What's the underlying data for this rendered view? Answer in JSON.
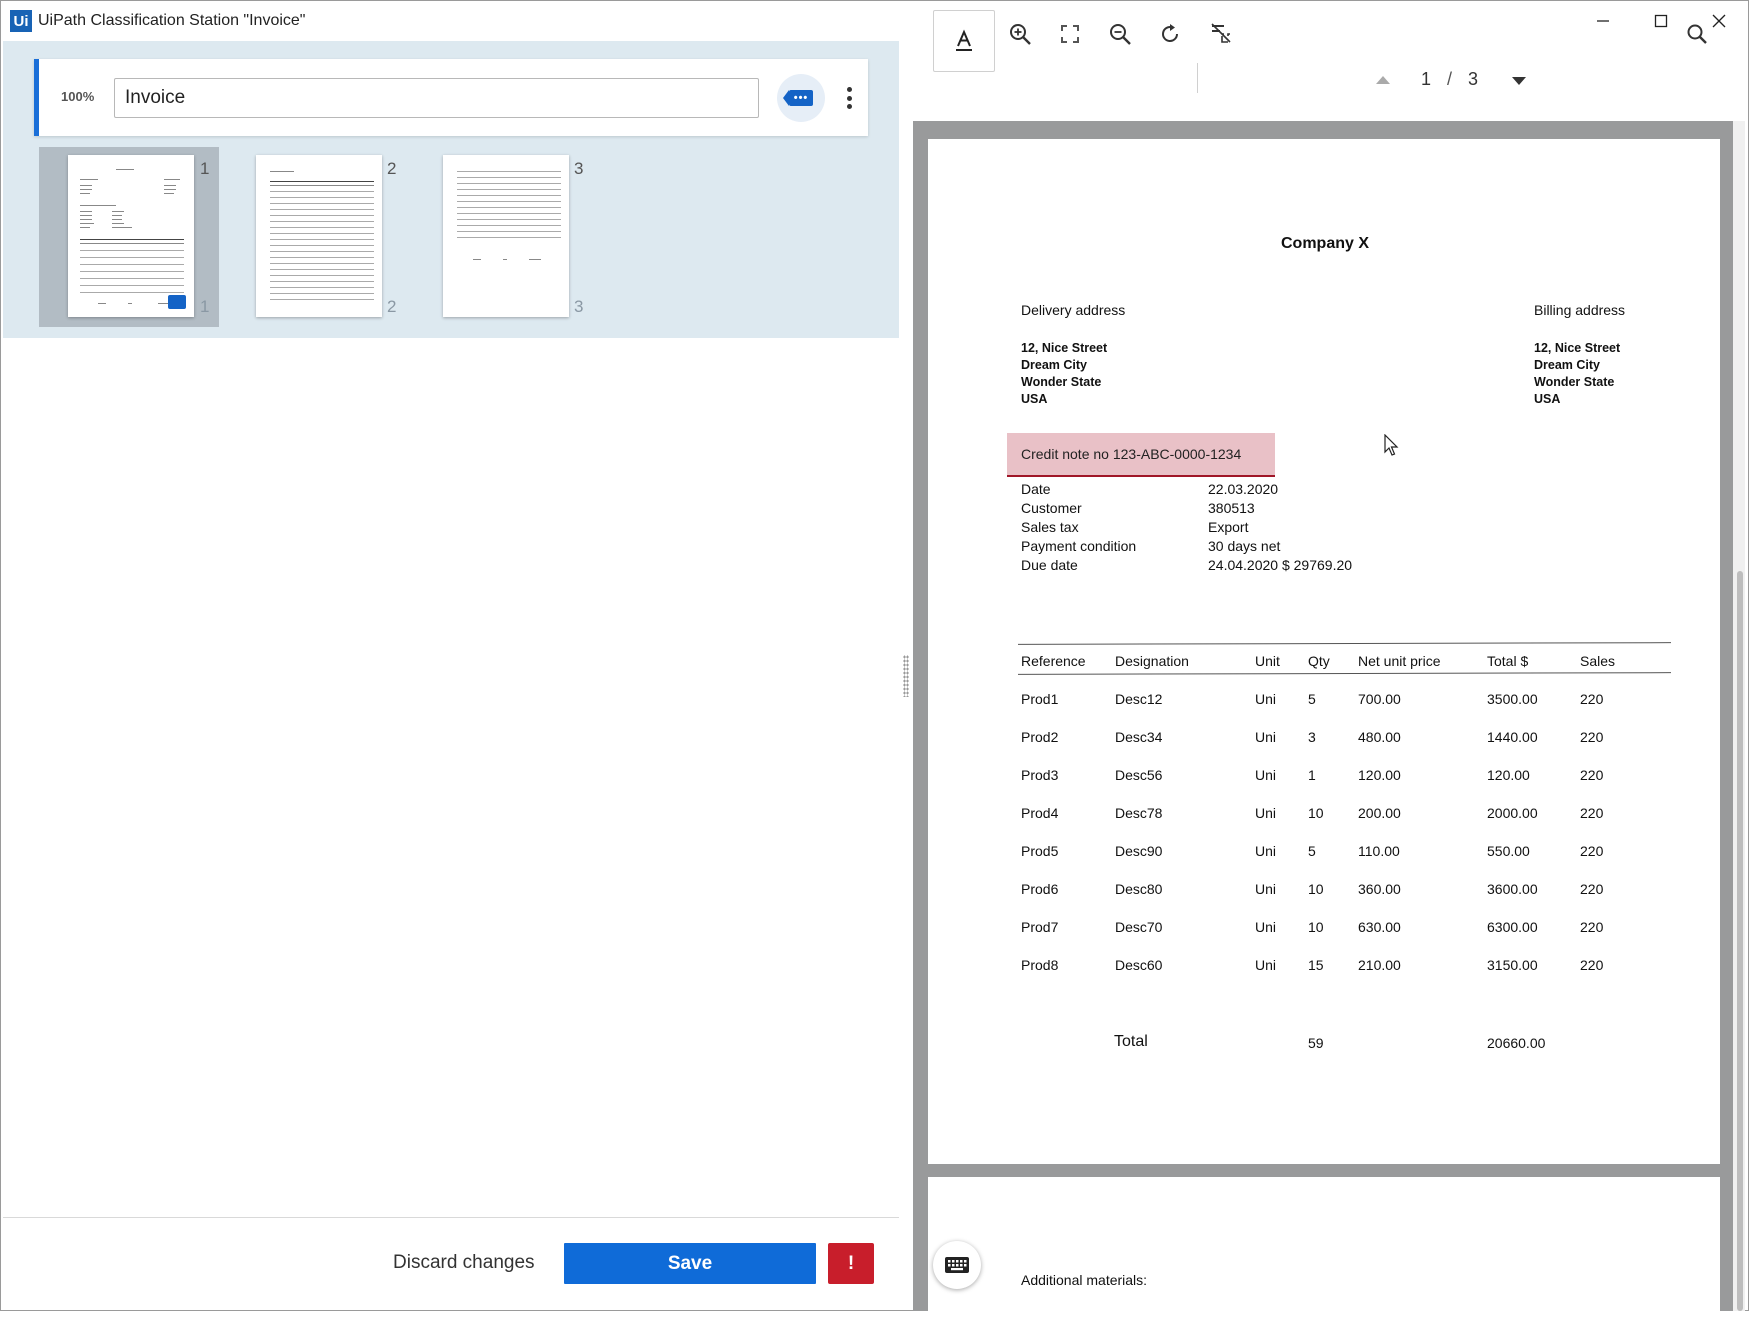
{
  "window": {
    "title": "UiPath Classification Station \"Invoice\"",
    "logo_text": "Ui"
  },
  "classification": {
    "confidence": "100%",
    "class_value": "Invoice"
  },
  "thumbnails": [
    {
      "label_top": "1",
      "label_bottom": "1"
    },
    {
      "label_top": "2",
      "label_bottom": "2"
    },
    {
      "label_top": "3",
      "label_bottom": "3"
    }
  ],
  "footer": {
    "discard_label": "Discard changes",
    "save_label": "Save",
    "warning_label": "!"
  },
  "viewer": {
    "current_page": "1",
    "separator": "/",
    "total_pages": "3"
  },
  "document": {
    "company": "Company X",
    "delivery_heading": "Delivery address",
    "billing_heading": "Billing address",
    "delivery_lines": [
      "12, Nice Street",
      "Dream City",
      "Wonder State",
      "USA"
    ],
    "billing_lines": [
      "12, Nice Street",
      "Dream City",
      "Wonder State",
      "USA"
    ],
    "credit_note": "Credit note no 123-ABC-0000-1234",
    "meta": [
      {
        "label": "Date",
        "value": "22.03.2020"
      },
      {
        "label": "Customer",
        "value": "380513"
      },
      {
        "label": "Sales tax",
        "value": "Export"
      },
      {
        "label": "Payment condition",
        "value": "30 days net"
      },
      {
        "label": "Due date",
        "value": "24.04.2020 $ 29769.20"
      }
    ],
    "columns": [
      "Reference",
      "Designation",
      "Unit",
      "Qty",
      "Net unit price",
      "Total $",
      "Sales"
    ],
    "rows": [
      [
        "Prod1",
        "Desc12",
        "Uni",
        "5",
        "700.00",
        "3500.00",
        "220"
      ],
      [
        "Prod2",
        "Desc34",
        "Uni",
        "3",
        "480.00",
        "1440.00",
        "220"
      ],
      [
        "Prod3",
        "Desc56",
        "Uni",
        "1",
        "120.00",
        "120.00",
        "220"
      ],
      [
        "Prod4",
        "Desc78",
        "Uni",
        "10",
        "200.00",
        "2000.00",
        "220"
      ],
      [
        "Prod5",
        "Desc90",
        "Uni",
        "5",
        "110.00",
        "550.00",
        "220"
      ],
      [
        "Prod6",
        "Desc80",
        "Uni",
        "10",
        "360.00",
        "3600.00",
        "220"
      ],
      [
        "Prod7",
        "Desc70",
        "Uni",
        "10",
        "630.00",
        "6300.00",
        "220"
      ],
      [
        "Prod8",
        "Desc60",
        "Uni",
        "15",
        "210.00",
        "3150.00",
        "220"
      ]
    ],
    "total_label": "Total",
    "total_qty": "59",
    "total_amount": "20660.00",
    "page2_heading": "Additional materials:"
  }
}
